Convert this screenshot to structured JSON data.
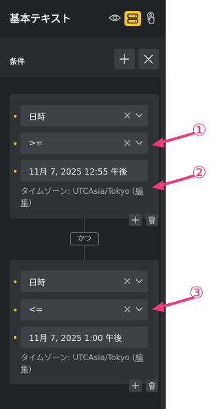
{
  "header": {
    "title": "基本テキスト"
  },
  "conditions": {
    "label": "条件",
    "cards": [
      {
        "field1": "日時",
        "field2": ">=",
        "field3": "11月 7, 2025 12:55 午後",
        "tz_prefix": "タイムゾーン: UTCAsia/Tokyo (",
        "tz_link": "編集",
        "tz_suffix": ")"
      },
      {
        "field1": "日時",
        "field2": "<=",
        "field3": "11月 7, 2025 1:00 午後",
        "tz_prefix": "タイムゾーン: UTCAsia/Tokyo (",
        "tz_link": "編集",
        "tz_suffix": ")"
      }
    ],
    "connector": "かつ"
  },
  "annotations": [
    "①",
    "②",
    "③"
  ],
  "colors": {
    "accent": "#f5c518",
    "callout": "#ee3a7c",
    "panel": "#1f2226"
  }
}
